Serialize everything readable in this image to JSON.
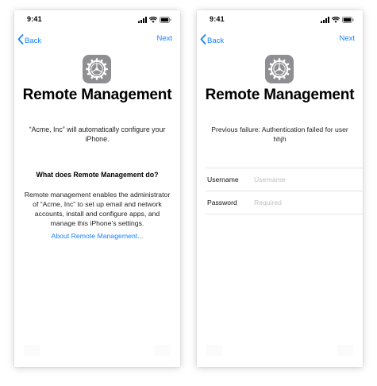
{
  "colors": {
    "accent": "#1a82fb",
    "settings_icon_bg": "#8e8e93"
  },
  "left_screen": {
    "status": {
      "time": "9:41",
      "icons": [
        "signal-icon",
        "wifi-icon",
        "battery-icon"
      ]
    },
    "navbar": {
      "back_label": "Back",
      "next_label": "Next"
    },
    "app_icon": "settings-gear-icon",
    "title": "Remote Management",
    "subtitle": "“Acme, Inc” will automatically configure your iPhone.",
    "section_heading": "What does Remote Management do?",
    "description": "Remote management enables the administrator of “Acme, Inc” to set up email and network accounts, install and configure apps, and manage this iPhone’s settings.",
    "link_label": "About Remote Management..."
  },
  "right_screen": {
    "status": {
      "time": "9:41",
      "icons": [
        "signal-icon",
        "wifi-icon",
        "battery-icon"
      ]
    },
    "navbar": {
      "back_label": "Back",
      "next_label": "Next"
    },
    "app_icon": "settings-gear-icon",
    "title": "Remote Management",
    "failure_message": "Previous failure: Authentication failed for user hhjh",
    "form": {
      "username": {
        "label": "Username",
        "placeholder": "Username",
        "value": ""
      },
      "password": {
        "label": "Password",
        "placeholder": "Required",
        "value": ""
      }
    }
  }
}
